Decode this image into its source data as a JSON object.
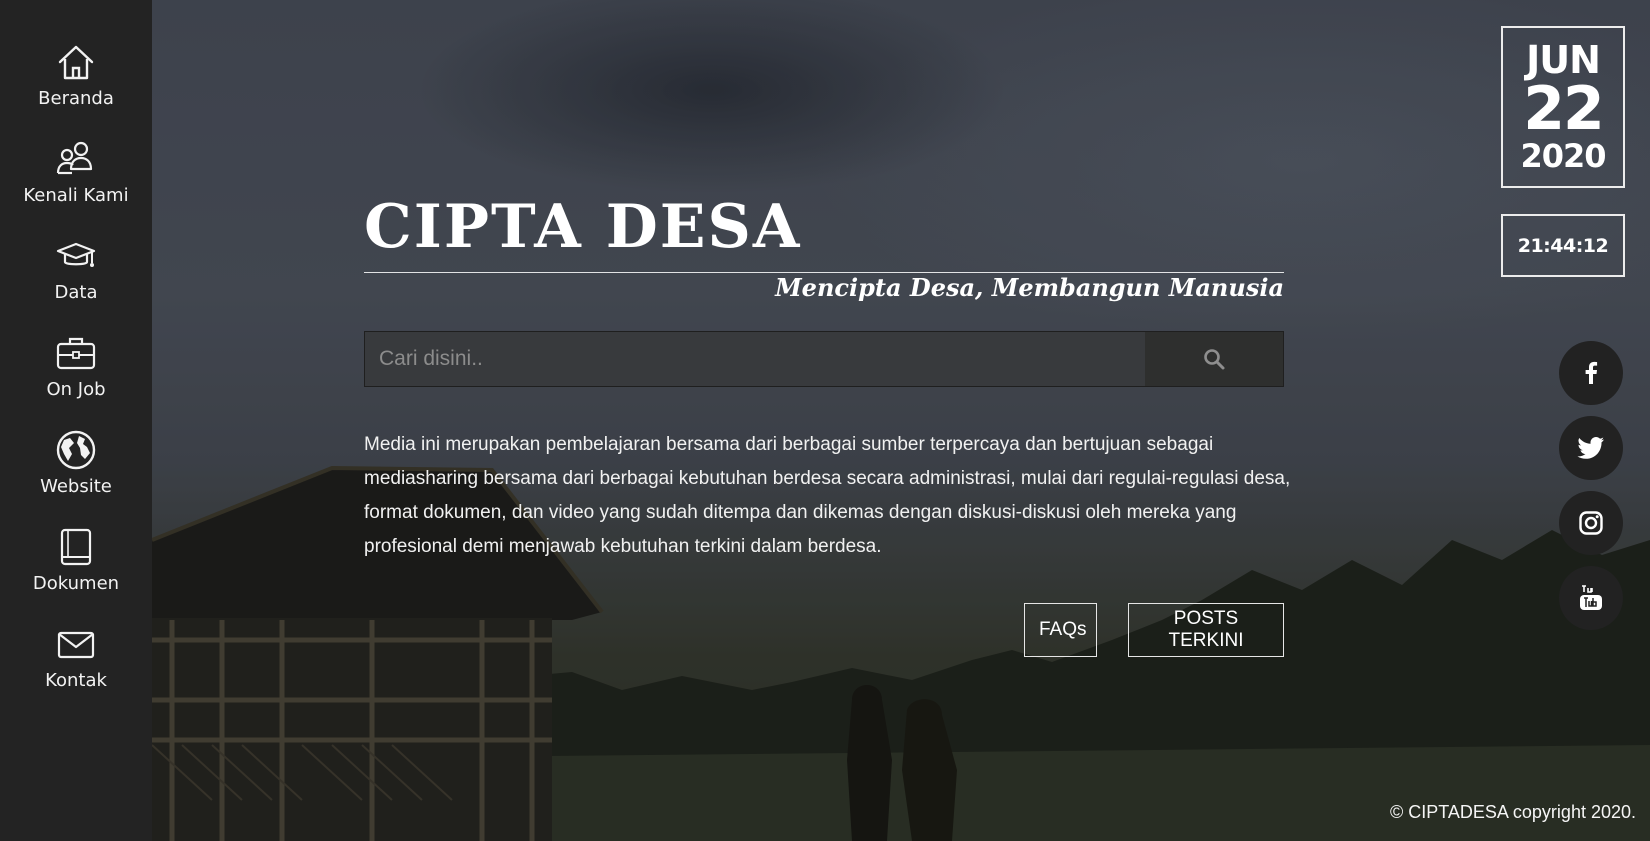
{
  "sidebar": {
    "items": [
      {
        "label": "Beranda",
        "icon": "home-icon"
      },
      {
        "label": "Kenali Kami",
        "icon": "users-icon"
      },
      {
        "label": "Data",
        "icon": "graduation-cap-icon"
      },
      {
        "label": "On Job",
        "icon": "briefcase-icon"
      },
      {
        "label": "Website",
        "icon": "globe-icon"
      },
      {
        "label": "Dokumen",
        "icon": "book-icon"
      },
      {
        "label": "Kontak",
        "icon": "envelope-icon"
      }
    ]
  },
  "hero": {
    "title": "CIPTA DESA",
    "tagline": "Mencipta Desa, Membangun Manusia",
    "search_placeholder": "Cari disini..",
    "search_value": "",
    "description": "Media ini merupakan pembelajaran bersama dari berbagai sumber terpercaya dan bertujuan sebagai mediasharing bersama dari berbagai kebutuhan berdesa secara administrasi, mulai dari regulai-regulasi desa, format dokumen, dan video yang sudah ditempa dan dikemas dengan diskusi-diskusi oleh mereka yang profesional demi menjawab kebutuhan terkini dalam berdesa.",
    "faq_label": "FAQs",
    "posts_label": "POSTS TERKINI"
  },
  "date": {
    "month": "JUN",
    "day": "22",
    "year": "2020",
    "time": "21:44:12"
  },
  "social": [
    "facebook-icon",
    "twitter-icon",
    "instagram-icon",
    "youtube-icon"
  ],
  "footer": {
    "copyright": "© CIPTADESA copyright 2020."
  },
  "colors": {
    "sidebar_bg": "#232323",
    "social_bg": "#222222",
    "text": "#ffffff"
  }
}
